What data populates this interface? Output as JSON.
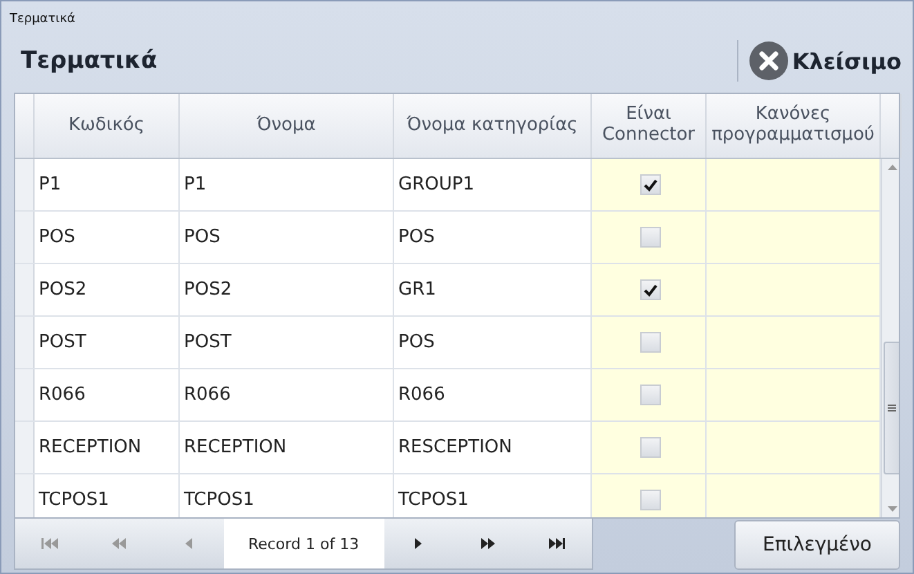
{
  "window": {
    "title": "Τερματικά"
  },
  "header": {
    "title": "Τερματικά",
    "close_button": "Κλείσιμο"
  },
  "table": {
    "columns": [
      "Κωδικός",
      "Όνομα",
      "Όνομα κατηγορίας",
      "Είναι Connector",
      "Κανόνες προγραμματισμού"
    ],
    "rows": [
      {
        "code": "P1",
        "name": "P1",
        "category": "GROUP1",
        "connector": true
      },
      {
        "code": "POS",
        "name": "POS",
        "category": "POS",
        "connector": false
      },
      {
        "code": "POS2",
        "name": "POS2",
        "category": "GR1",
        "connector": true
      },
      {
        "code": "POST",
        "name": "POST",
        "category": "POS",
        "connector": false
      },
      {
        "code": "R066",
        "name": "R066",
        "category": "R066",
        "connector": false
      },
      {
        "code": "RECEPTION",
        "name": "RECEPTION",
        "category": "RESCEPTION",
        "connector": false
      },
      {
        "code": "TCPOS1",
        "name": "TCPOS1",
        "category": "TCPOS1",
        "connector": false
      }
    ]
  },
  "navigator": {
    "record": "Record 1 of 13"
  },
  "select_button": "Επιλεγμένο"
}
